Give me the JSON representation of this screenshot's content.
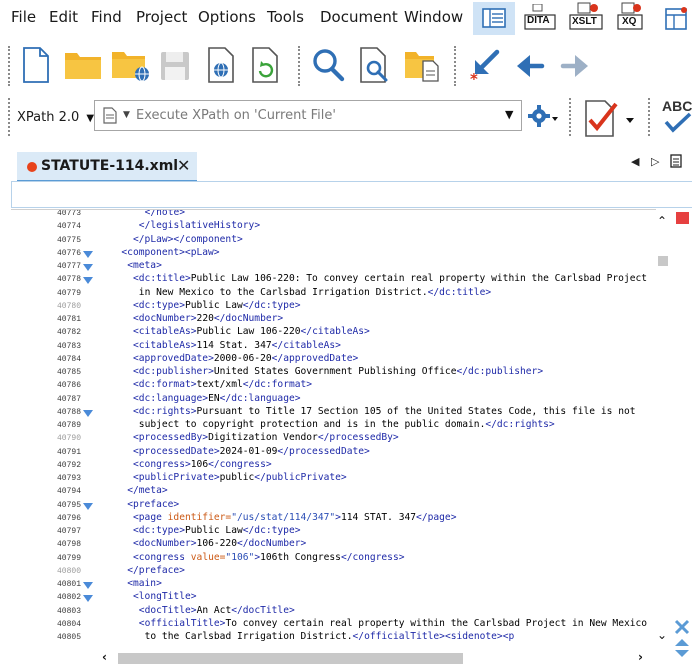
{
  "menu": [
    "File",
    "Edit",
    "Find",
    "Project",
    "Options",
    "Tools",
    "Document",
    "Window"
  ],
  "toolbar": {
    "dita_label": "DITA",
    "xslt_label": "XSLT",
    "xq_label": "XQ",
    "abc_label": "ABC"
  },
  "xpath": {
    "version": "XPath 2.0",
    "placeholder": "Execute XPath on  'Current File'"
  },
  "tab": {
    "title": "STATUTE-114.xml",
    "close": "✕"
  },
  "lines": [
    {
      "n": "40773",
      "fold": false,
      "dim": false
    },
    {
      "n": "40774",
      "fold": false,
      "dim": false
    },
    {
      "n": "40775",
      "fold": false,
      "dim": false
    },
    {
      "n": "40776",
      "fold": true,
      "dim": false
    },
    {
      "n": "40777",
      "fold": true,
      "dim": false
    },
    {
      "n": "40778",
      "fold": true,
      "dim": false
    },
    {
      "n": "40779",
      "fold": false,
      "dim": false
    },
    {
      "n": "40780",
      "fold": false,
      "dim": true
    },
    {
      "n": "40781",
      "fold": false,
      "dim": false
    },
    {
      "n": "40782",
      "fold": false,
      "dim": false
    },
    {
      "n": "40783",
      "fold": false,
      "dim": false
    },
    {
      "n": "40784",
      "fold": false,
      "dim": false
    },
    {
      "n": "40785",
      "fold": false,
      "dim": false
    },
    {
      "n": "40786",
      "fold": false,
      "dim": false
    },
    {
      "n": "40787",
      "fold": false,
      "dim": false
    },
    {
      "n": "40788",
      "fold": true,
      "dim": false
    },
    {
      "n": "40789",
      "fold": false,
      "dim": false
    },
    {
      "n": "40790",
      "fold": false,
      "dim": true
    },
    {
      "n": "40791",
      "fold": false,
      "dim": false
    },
    {
      "n": "40792",
      "fold": false,
      "dim": false
    },
    {
      "n": "40793",
      "fold": false,
      "dim": false
    },
    {
      "n": "40794",
      "fold": false,
      "dim": false
    },
    {
      "n": "40795",
      "fold": true,
      "dim": false
    },
    {
      "n": "40796",
      "fold": false,
      "dim": false
    },
    {
      "n": "40797",
      "fold": false,
      "dim": false
    },
    {
      "n": "40798",
      "fold": false,
      "dim": false
    },
    {
      "n": "40799",
      "fold": false,
      "dim": false
    },
    {
      "n": "40800",
      "fold": false,
      "dim": true
    },
    {
      "n": "40801",
      "fold": true,
      "dim": false
    },
    {
      "n": "40802",
      "fold": true,
      "dim": false
    },
    {
      "n": "40803",
      "fold": false,
      "dim": false
    },
    {
      "n": "40804",
      "fold": false,
      "dim": false
    },
    {
      "n": "40805",
      "fold": false,
      "dim": false
    }
  ],
  "code": [
    {
      "i": 12,
      "html": "<span class='t'>&lt;/note&gt;</span>"
    },
    {
      "i": 11,
      "html": "<span class='t'>&lt;/legislativeHistory&gt;</span>"
    },
    {
      "i": 10,
      "html": "<span class='t'>&lt;/pLaw&gt;&lt;/component&gt;</span>"
    },
    {
      "i": 8,
      "html": "<span class='t'>&lt;component&gt;&lt;pLaw&gt;</span>"
    },
    {
      "i": 9,
      "html": "<span class='t'>&lt;meta&gt;</span>"
    },
    {
      "i": 10,
      "html": "<span class='t'>&lt;dc:title&gt;</span>Public Law 106-220: To convey certain real property within the Carlsbad Project"
    },
    {
      "i": 11,
      "html": "in New Mexico to the Carlsbad Irrigation District.<span class='t'>&lt;/dc:title&gt;</span>"
    },
    {
      "i": 10,
      "html": "<span class='t'>&lt;dc:type&gt;</span>Public Law<span class='t'>&lt;/dc:type&gt;</span>"
    },
    {
      "i": 10,
      "html": "<span class='t'>&lt;docNumber&gt;</span>220<span class='t'>&lt;/docNumber&gt;</span>"
    },
    {
      "i": 10,
      "html": "<span class='t'>&lt;citableAs&gt;</span>Public Law 106-220<span class='t'>&lt;/citableAs&gt;</span>"
    },
    {
      "i": 10,
      "html": "<span class='t'>&lt;citableAs&gt;</span>114 Stat. 347<span class='t'>&lt;/citableAs&gt;</span>"
    },
    {
      "i": 10,
      "html": "<span class='t'>&lt;approvedDate&gt;</span>2000-06-20<span class='t'>&lt;/approvedDate&gt;</span>"
    },
    {
      "i": 10,
      "html": "<span class='t'>&lt;dc:publisher&gt;</span>United States Government Publishing Office<span class='t'>&lt;/dc:publisher&gt;</span>"
    },
    {
      "i": 10,
      "html": "<span class='t'>&lt;dc:format&gt;</span>text/xml<span class='t'>&lt;/dc:format&gt;</span>"
    },
    {
      "i": 10,
      "html": "<span class='t'>&lt;dc:language&gt;</span>EN<span class='t'>&lt;/dc:language&gt;</span>"
    },
    {
      "i": 10,
      "html": "<span class='t'>&lt;dc:rights&gt;</span>Pursuant to Title 17 Section 105 of the United States Code, this file is not"
    },
    {
      "i": 11,
      "html": "subject to copyright protection and is in the public domain.<span class='t'>&lt;/dc:rights&gt;</span>"
    },
    {
      "i": 10,
      "html": "<span class='t'>&lt;processedBy&gt;</span>Digitization Vendor<span class='t'>&lt;/processedBy&gt;</span>"
    },
    {
      "i": 10,
      "html": "<span class='t'>&lt;processedDate&gt;</span>2024-01-09<span class='t'>&lt;/processedDate&gt;</span>"
    },
    {
      "i": 10,
      "html": "<span class='t'>&lt;congress&gt;</span>106<span class='t'>&lt;/congress&gt;</span>"
    },
    {
      "i": 10,
      "html": "<span class='t'>&lt;publicPrivate&gt;</span>public<span class='t'>&lt;/publicPrivate&gt;</span>"
    },
    {
      "i": 9,
      "html": "<span class='t'>&lt;/meta&gt;</span>"
    },
    {
      "i": 9,
      "html": "<span class='t'>&lt;preface&gt;</span>"
    },
    {
      "i": 10,
      "html": "<span class='t'>&lt;page </span><span class='a'>identifier=</span><span class='v'>\"/us/stat/114/347\"</span><span class='t'>&gt;</span>114 STAT. 347<span class='t'>&lt;/page&gt;</span>"
    },
    {
      "i": 10,
      "html": "<span class='t'>&lt;dc:type&gt;</span>Public Law<span class='t'>&lt;/dc:type&gt;</span>"
    },
    {
      "i": 10,
      "html": "<span class='t'>&lt;docNumber&gt;</span>106-220<span class='t'>&lt;/docNumber&gt;</span>"
    },
    {
      "i": 10,
      "html": "<span class='t'>&lt;congress </span><span class='a'>value=</span><span class='v'>\"106\"</span><span class='t'>&gt;</span>106th Congress<span class='t'>&lt;/congress&gt;</span>"
    },
    {
      "i": 9,
      "html": "<span class='t'>&lt;/preface&gt;</span>"
    },
    {
      "i": 9,
      "html": "<span class='t'>&lt;main&gt;</span>"
    },
    {
      "i": 10,
      "html": "<span class='t'>&lt;longTitle&gt;</span>"
    },
    {
      "i": 11,
      "html": "<span class='t'>&lt;docTitle&gt;</span>An Act<span class='t'>&lt;/docTitle&gt;</span>"
    },
    {
      "i": 11,
      "html": "<span class='t'>&lt;officialTitle&gt;</span>To convey certain real property within the Carlsbad Project in New Mexico"
    },
    {
      "i": 12,
      "html": "to the Carlsbad Irrigation District.<span class='t'>&lt;/officialTitle&gt;</span><span class='t'>&lt;sidenote&gt;</span><span class='t'>&lt;p</span>"
    }
  ]
}
